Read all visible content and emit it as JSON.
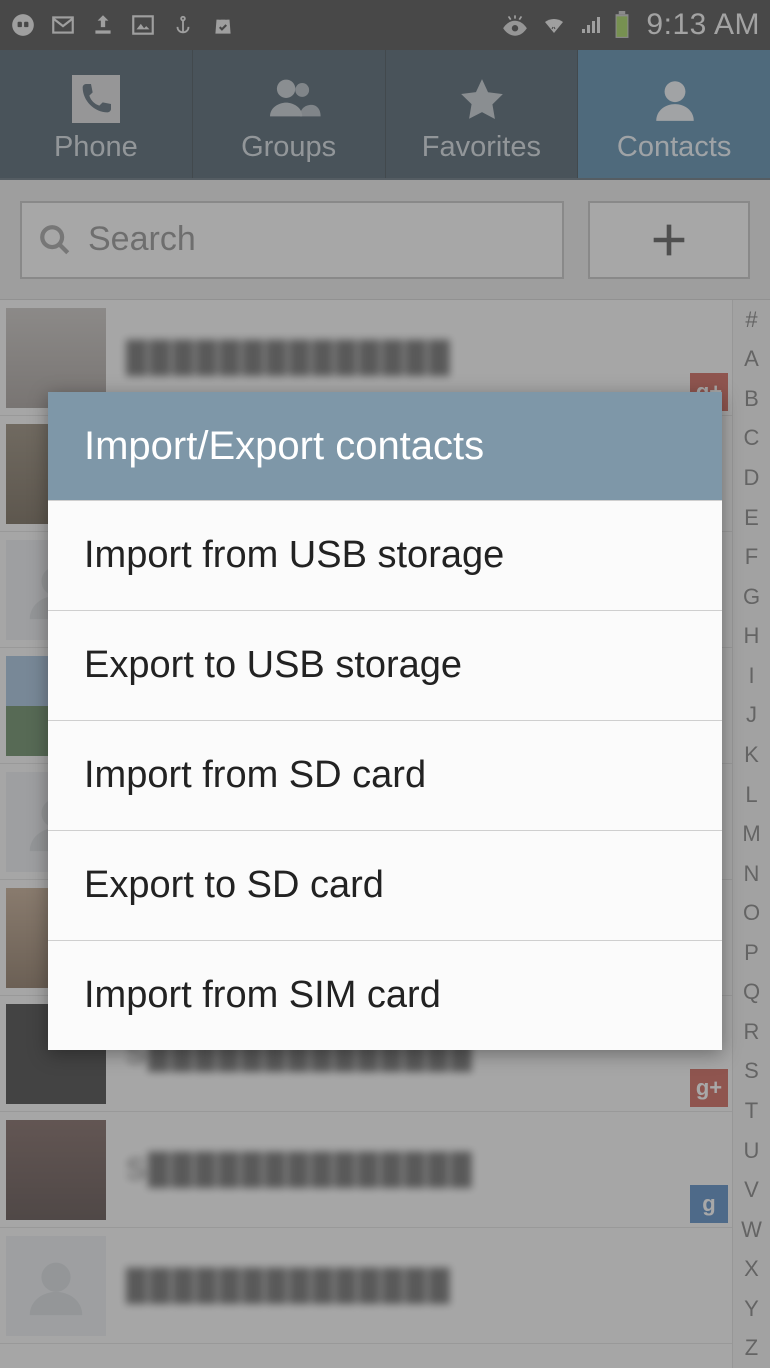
{
  "status": {
    "time": "9:13 AM"
  },
  "tabs": {
    "phone": "Phone",
    "groups": "Groups",
    "favorites": "Favorites",
    "contacts": "Contacts"
  },
  "search": {
    "placeholder": "Search"
  },
  "index": {
    "items": [
      "#",
      "A",
      "B",
      "C",
      "D",
      "E",
      "F",
      "G",
      "H",
      "I",
      "J",
      "K",
      "L",
      "M",
      "N",
      "O",
      "P",
      "Q",
      "R",
      "S",
      "T",
      "U",
      "V",
      "W",
      "X",
      "Y",
      "Z"
    ]
  },
  "dialog": {
    "title": "Import/Export contacts",
    "items": [
      "Import from USB storage",
      "Export to USB storage",
      "Import from SD card",
      "Export to SD card",
      "Import from SIM card"
    ]
  }
}
